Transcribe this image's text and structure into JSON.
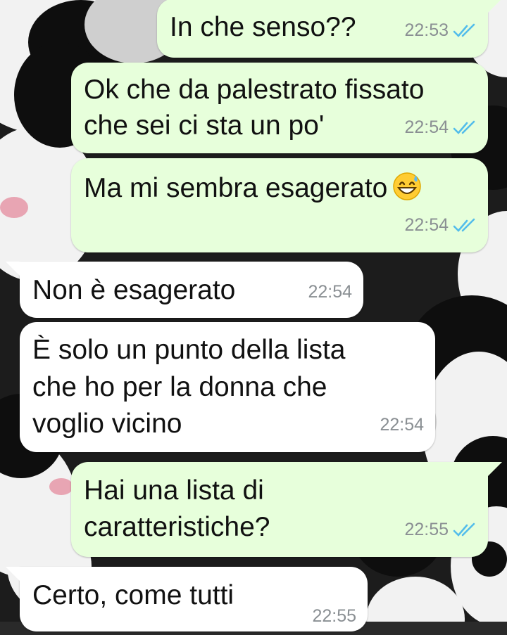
{
  "messages": [
    {
      "text": "In che senso??",
      "time": "22:53",
      "direction": "outgoing",
      "status": "read"
    },
    {
      "lines": [
        "Ok che da palestrato fissato",
        "che sei ci sta un po'"
      ],
      "time": "22:54",
      "direction": "outgoing",
      "status": "read"
    },
    {
      "text": "Ma mi sembra esagerato",
      "emoji": "grinning-face-with-sweat",
      "time": "22:54",
      "direction": "outgoing",
      "status": "read"
    },
    {
      "text": "Non è esagerato",
      "time": "22:54",
      "direction": "incoming"
    },
    {
      "lines": [
        "È solo un punto della lista",
        "che ho per la donna che",
        "voglio vicino"
      ],
      "time": "22:54",
      "direction": "incoming"
    },
    {
      "lines": [
        "Hai una lista di",
        "caratteristiche?"
      ],
      "time": "22:55",
      "direction": "outgoing",
      "status": "read"
    },
    {
      "text": "Certo, come tutti",
      "time": "22:55",
      "direction": "incoming"
    }
  ],
  "colors": {
    "outgoing_bubble": "#e7ffdb",
    "incoming_bubble": "#ffffff",
    "read_ticks": "#53bdeb",
    "timestamp": "#8a8f93"
  },
  "icons": {
    "read_receipt": "double-check-icon"
  }
}
